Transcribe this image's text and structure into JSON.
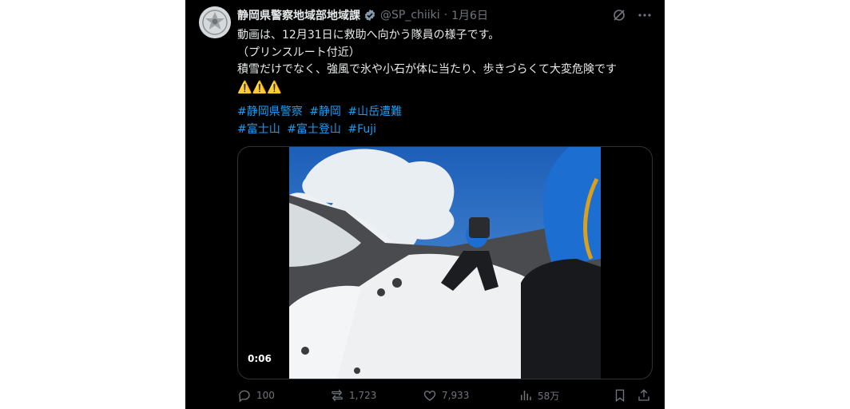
{
  "author": {
    "name": "静岡県警察地域部地域課",
    "handle": "@SP_chiiki",
    "separator": "·",
    "date": "1月6日"
  },
  "text": {
    "line1": "動画は、12月31日に救助へ向かう隊員の様子です。",
    "line2": "（プリンスルート付近）",
    "line3": "積雪だけでなく、強風で氷や小石が体に当たり、歩きづらくて大変危険です",
    "line4": "⚠️⚠️⚠️"
  },
  "hashtags": {
    "row1": [
      "#静岡県警察",
      "#静岡",
      "#山岳遭難"
    ],
    "row2": [
      "#富士山",
      "#富士登山",
      "#Fuji"
    ]
  },
  "media": {
    "duration": "0:06"
  },
  "stats": {
    "replies": "100",
    "reposts": "1,723",
    "likes": "7,933",
    "views": "58万"
  },
  "icons": {
    "verified": "verified-badge-icon",
    "grok": "grok-icon",
    "more": "more-icon",
    "reply": "reply-icon",
    "repost": "repost-icon",
    "like": "like-icon",
    "views": "views-icon",
    "bookmark": "bookmark-icon",
    "share": "share-icon"
  },
  "colors": {
    "background": "#000000",
    "text": "#e7e9ea",
    "secondary": "#71767b",
    "link": "#1d9bf0"
  }
}
